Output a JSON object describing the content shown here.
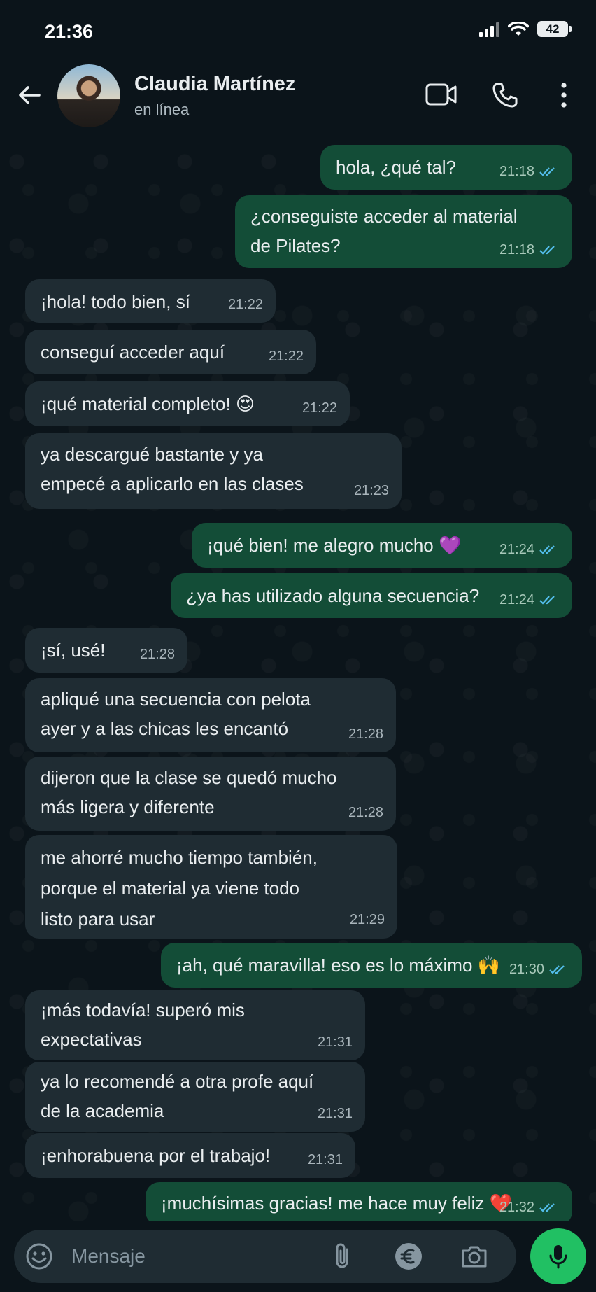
{
  "status_bar": {
    "time": "21:36",
    "battery": "42"
  },
  "header": {
    "contact_name": "Claudia Martínez",
    "contact_status": "en línea"
  },
  "messages": [
    {
      "dir": "out",
      "text": "hola, ¿qué tal?",
      "time": "21:18"
    },
    {
      "dir": "out",
      "text": "¿conseguiste acceder al material\nde Pilates?",
      "time": "21:18"
    },
    {
      "dir": "in",
      "text": "¡hola! todo bien, sí",
      "time": "21:22"
    },
    {
      "dir": "in",
      "text": "conseguí acceder aquí",
      "time": "21:22"
    },
    {
      "dir": "in",
      "text": "¡qué material completo! 😍",
      "time": "21:22"
    },
    {
      "dir": "in",
      "text": "ya descargué bastante y ya\nempecé a aplicarlo en las clases",
      "time": "21:23"
    },
    {
      "dir": "out",
      "text": "¡qué bien! me alegro mucho 💜",
      "time": "21:24"
    },
    {
      "dir": "out",
      "text": "¿ya has utilizado alguna secuencia?",
      "time": "21:24"
    },
    {
      "dir": "in",
      "text": "¡sí, usé!",
      "time": "21:28"
    },
    {
      "dir": "in",
      "text": "apliqué una secuencia con pelota\nayer y a las chicas les encantó",
      "time": "21:28"
    },
    {
      "dir": "in",
      "text": "dijeron que la clase se quedó mucho\nmás ligera y diferente",
      "time": "21:28"
    },
    {
      "dir": "in",
      "text": "me ahorré mucho tiempo también,\nporque el material ya viene todo\nlisto para usar",
      "time": "21:29"
    },
    {
      "dir": "out",
      "text": "¡ah, qué maravilla! eso es lo máximo 🙌",
      "time": "21:30"
    },
    {
      "dir": "in",
      "text": "¡más todavía! superó mis\nexpectativas",
      "time": "21:31"
    },
    {
      "dir": "in",
      "text": "ya lo recomendé a otra profe aquí\nde la academia",
      "time": "21:31"
    },
    {
      "dir": "in",
      "text": "¡enhorabuena por el trabajo!",
      "time": "21:31"
    },
    {
      "dir": "out",
      "text": "¡muchísimas gracias! me hace muy feliz ❤️",
      "time": "21:32"
    }
  ],
  "composer": {
    "placeholder": "Mensaje"
  },
  "icons": {
    "back": "arrow-left-icon",
    "video": "video-call-icon",
    "call": "phone-icon",
    "menu": "more-vert-icon",
    "emoji": "emoji-icon",
    "attach": "paperclip-icon",
    "payment": "euro-icon",
    "camera": "camera-icon",
    "mic": "microphone-icon",
    "ticks": "double-check-icon"
  },
  "colors": {
    "background": "#0b141a",
    "incoming": "#1f2c33",
    "outgoing": "#134d37",
    "read_ticks": "#53bdeb",
    "accent": "#21c063"
  }
}
